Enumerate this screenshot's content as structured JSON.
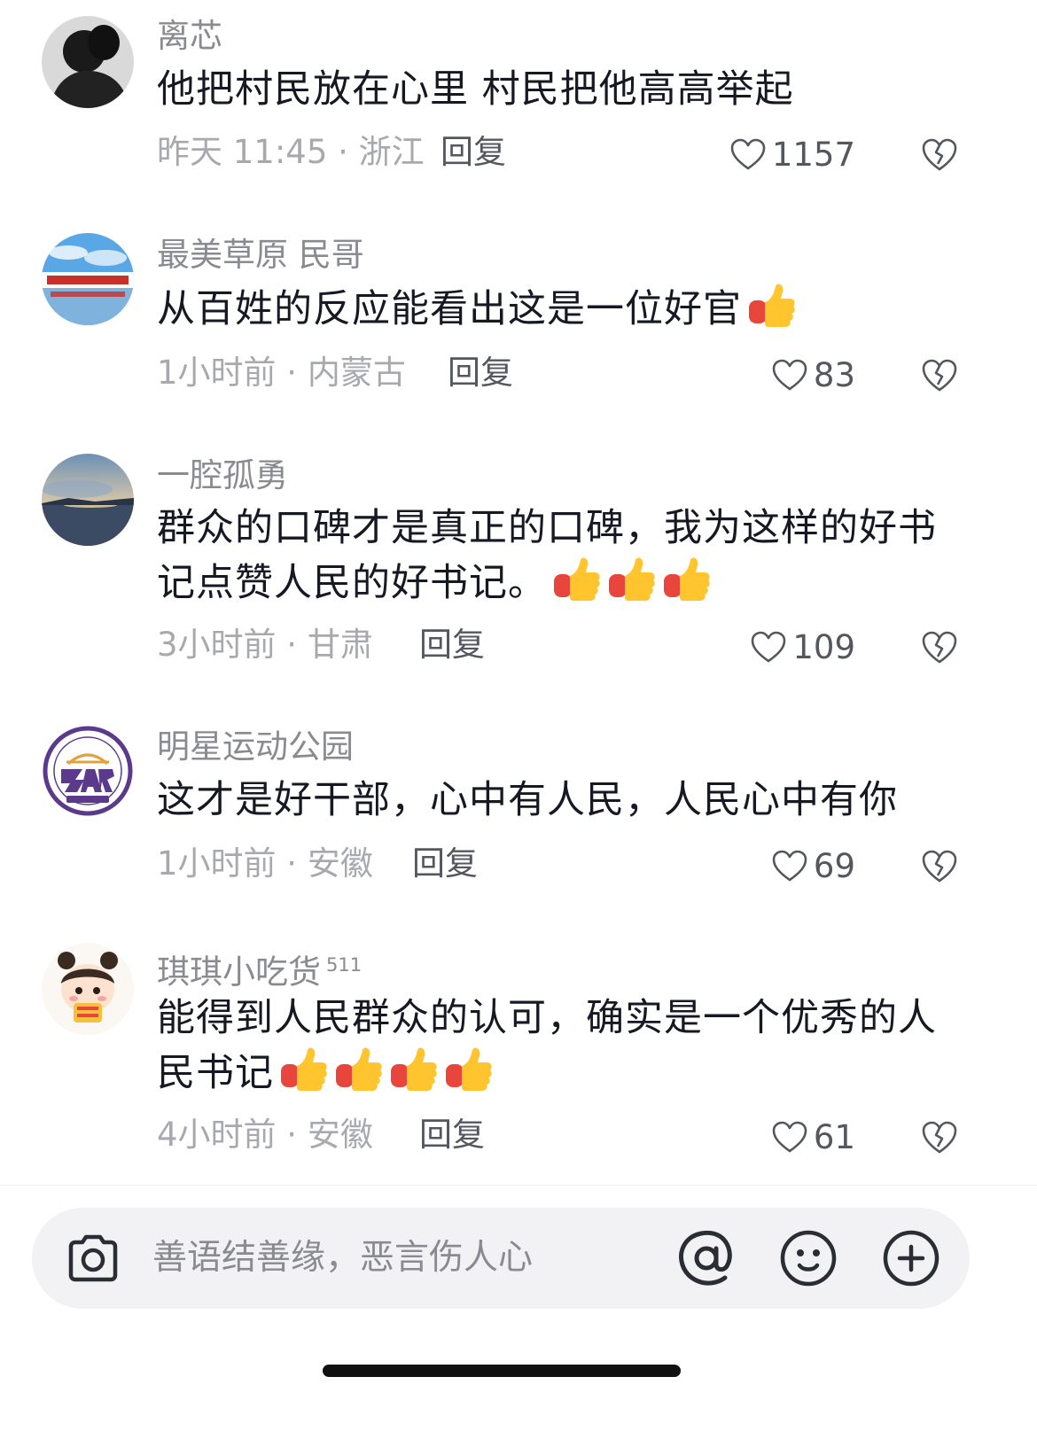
{
  "comments": [
    {
      "username": "离芯",
      "badge": "",
      "text": "他把村民放在心里 村民把他高高举起",
      "thumbs": 0,
      "meta": "昨天 11:45 · 浙江",
      "reply_label": "回复",
      "likes": "1157",
      "avatar_icon": "person-silhouette-avatar"
    },
    {
      "username": "最美草原  民哥",
      "badge": "",
      "text": "从百姓的反应能看出这是一位好官",
      "thumbs": 1,
      "meta": "1小时前 · 内蒙古",
      "reply_label": "回复",
      "likes": "83",
      "avatar_icon": "grassland-sign-avatar"
    },
    {
      "username": "一腔孤勇",
      "badge": "",
      "text": "群众的口碑才是真正的口碑，我为这样的好书记点赞人民的好书记。",
      "thumbs": 3,
      "meta": "3小时前 · 甘肃",
      "reply_label": "回复",
      "likes": "109",
      "avatar_icon": "lake-sunset-avatar"
    },
    {
      "username": "明星运动公园",
      "badge": "",
      "text": "这才是好干部，心中有人民，人民心中有你",
      "thumbs": 0,
      "meta": "1小时前 · 安徽",
      "reply_label": "回复",
      "likes": "69",
      "avatar_icon": "star-sports-park-logo-avatar"
    },
    {
      "username": "琪琪小吃货",
      "badge": "511",
      "text": "能得到人民群众的认可，确实是一个优秀的人民书记",
      "thumbs": 4,
      "meta": "4小时前 · 安徽",
      "reply_label": "回复",
      "likes": "61",
      "avatar_icon": "cartoon-girl-avatar"
    }
  ],
  "input_bar": {
    "placeholder": "善语结善缘，恶言伤人心"
  },
  "colors": {
    "text_primary": "#161823",
    "text_secondary": "#8a8b91",
    "text_meta": "#a8a9ae",
    "input_bg": "#f2f2f4",
    "thumb_yellow": "#ffc42e",
    "thumb_red": "#e8453c"
  }
}
